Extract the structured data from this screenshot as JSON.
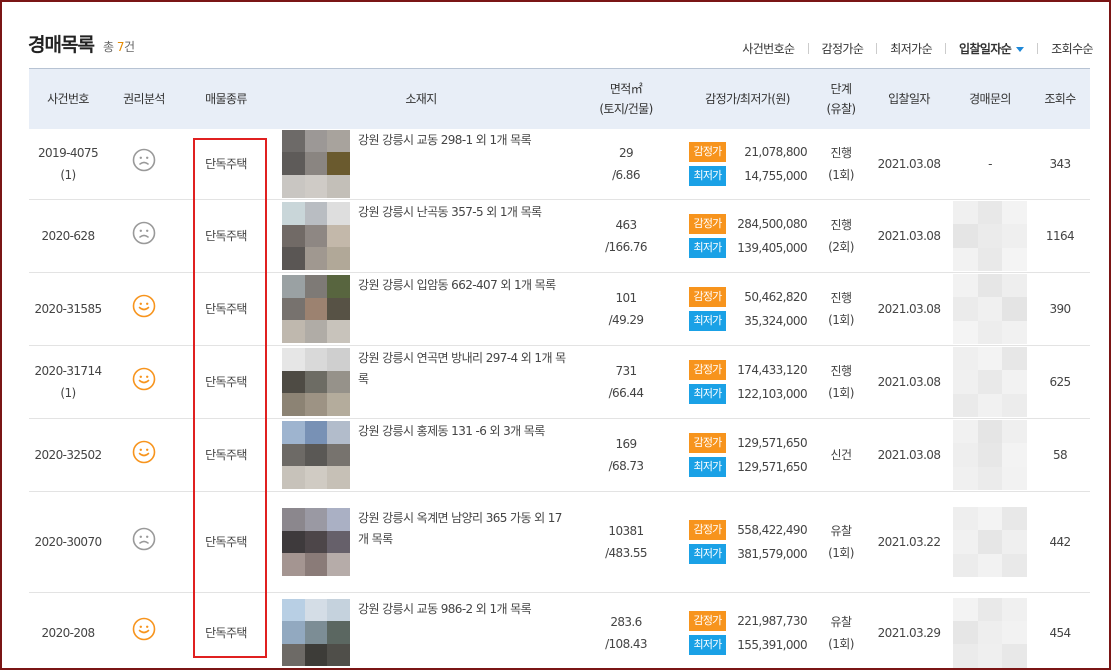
{
  "header": {
    "title": "경매목록",
    "count_prefix": "총",
    "count": "7",
    "count_suffix": "건"
  },
  "sort": {
    "case_number": "사건번호순",
    "appraisal": "감정가순",
    "minimum": "최저가순",
    "bid_date": "입찰일자순",
    "views": "조회수순"
  },
  "columns": {
    "case_number": "사건번호",
    "rights": "권리분석",
    "property_type": "매물종류",
    "location": "소재지",
    "area_top": "면적㎡",
    "area_bottom": "(토지/건물)",
    "price": "감정가/최저가(원)",
    "stage_top": "단계",
    "stage_bottom": "(유찰)",
    "bid_date": "입찰일자",
    "inquiry": "경매문의",
    "views": "조회수"
  },
  "labels": {
    "appraise": "감정가",
    "minimum": "최저가"
  },
  "colors": {
    "highlight_box": "#e02020",
    "appraise_badge": "#f7941d",
    "minimum_badge": "#1aa1e6",
    "good_icon": "#f7941d",
    "bad_icon": "#999999"
  },
  "rows": [
    {
      "case": "2019-4075",
      "case_sub": "(1)",
      "rights": "sad-face-icon",
      "type": "단독주택",
      "address": "강원 강릉시 교동 298-1 외 1개 목록",
      "land": "29",
      "building": "/6.86",
      "appraise": "21,078,800",
      "minimum": "14,755,000",
      "stage": "진행",
      "fails": "(1회)",
      "date": "2021.03.08",
      "inquiry": "-",
      "views": "343"
    },
    {
      "case": "2020-628",
      "case_sub": "",
      "rights": "sad-face-icon",
      "type": "단독주택",
      "address": "강원 강릉시 난곡동 357-5 외 1개 목록",
      "land": "463",
      "building": "/166.76",
      "appraise": "284,500,080",
      "minimum": "139,405,000",
      "stage": "진행",
      "fails": "(2회)",
      "date": "2021.03.08",
      "inquiry": "",
      "views": "1164"
    },
    {
      "case": "2020-31585",
      "case_sub": "",
      "rights": "smile-face-icon",
      "type": "단독주택",
      "address": "강원 강릉시 입암동 662-407 외 1개 목록",
      "land": "101",
      "building": "/49.29",
      "appraise": "50,462,820",
      "minimum": "35,324,000",
      "stage": "진행",
      "fails": "(1회)",
      "date": "2021.03.08",
      "inquiry": "",
      "views": "390"
    },
    {
      "case": "2020-31714",
      "case_sub": "(1)",
      "rights": "smile-face-icon",
      "type": "단독주택",
      "address": "강원 강릉시 연곡면 방내리 297-4 외 1개 목록",
      "land": "731",
      "building": "/66.44",
      "appraise": "174,433,120",
      "minimum": "122,103,000",
      "stage": "진행",
      "fails": "(1회)",
      "date": "2021.03.08",
      "inquiry": "",
      "views": "625"
    },
    {
      "case": "2020-32502",
      "case_sub": "",
      "rights": "smile-face-icon",
      "type": "단독주택",
      "address": "강원 강릉시 홍제동 131 -6 외 3개 목록",
      "land": "169",
      "building": "/68.73",
      "appraise": "129,571,650",
      "minimum": "129,571,650",
      "stage": "신건",
      "fails": "",
      "date": "2021.03.08",
      "inquiry": "",
      "views": "58"
    },
    {
      "case": "2020-30070",
      "case_sub": "",
      "rights": "sad-face-icon",
      "type": "단독주택",
      "address": "강원 강릉시 옥계면 남양리 365 가동 외 17개 목록",
      "land": "10381",
      "building": "/483.55",
      "appraise": "558,422,490",
      "minimum": "381,579,000",
      "stage": "유찰",
      "fails": "(1회)",
      "date": "2021.03.22",
      "inquiry": "",
      "views": "442"
    },
    {
      "case": "2020-208",
      "case_sub": "",
      "rights": "smile-face-icon",
      "type": "단독주택",
      "address": "강원 강릉시 교동 986-2 외 1개 목록",
      "land": "283.6",
      "building": "/108.43",
      "appraise": "221,987,730",
      "minimum": "155,391,000",
      "stage": "유찰",
      "fails": "(1회)",
      "date": "2021.03.29",
      "inquiry": "",
      "views": "454"
    }
  ]
}
